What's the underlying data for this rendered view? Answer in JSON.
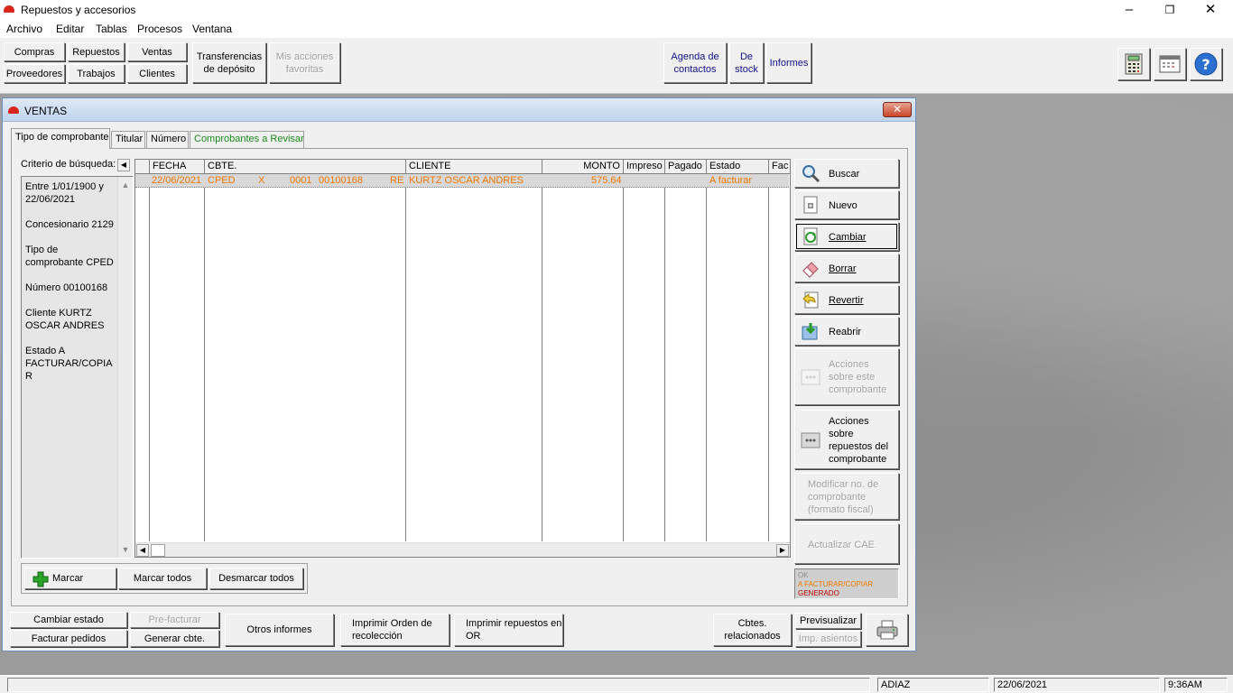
{
  "app": {
    "title": "Repuestos y accesorios"
  },
  "menu": [
    "Archivo",
    "Editar",
    "Tablas",
    "Procesos",
    "Ventana"
  ],
  "toolbar": {
    "compras": "Compras",
    "repuestos": "Repuestos",
    "ventas": "Ventas",
    "proveedores": "Proveedores",
    "trabajos": "Trabajos",
    "clientes": "Clientes",
    "transferencias": "Transferencias de depósito",
    "mis_acciones": "Mis acciones favoritas",
    "agenda": "Agenda de contactos",
    "de_stock": "De stock",
    "informes": "Informes",
    "calculator_icon": "calculator-icon",
    "calendar_icon": "calendar-icon",
    "help_icon": "help-icon"
  },
  "window": {
    "title": "VENTAS",
    "close": "✕"
  },
  "tabs": [
    "Tipo de comprobante",
    "Titular",
    "Número",
    "Comprobantes a Revisar"
  ],
  "criteria": {
    "label": "Criterio de búsqueda:",
    "lines": [
      "Entre  1/01/1900 y 22/06/2021",
      "Concesionario 2129",
      "Tipo de comprobante CPED",
      "Número 00100168",
      "Cliente KURTZ OSCAR ANDRES",
      "Estado A FACTURAR/COPIA R"
    ]
  },
  "grid": {
    "headers": {
      "fecha": "FECHA",
      "cbte": "CBTE.",
      "cliente": "CLIENTE",
      "monto": "MONTO",
      "impreso": "Impreso",
      "pagado": "Pagado",
      "estado": "Estado",
      "fac": "Fac"
    },
    "row": {
      "fecha": "22/06/2021",
      "tipo": "CPED",
      "letra": "X",
      "pv": "0001",
      "numero": "00100168",
      "suf": "RE",
      "cliente": "KURTZ OSCAR ANDRES",
      "monto": "575.64",
      "estado": "A facturar"
    },
    "row_color": "#f07800"
  },
  "actions": {
    "buscar": "Buscar",
    "nuevo": "Nuevo",
    "cambiar": "Cambiar",
    "borrar": "Borrar",
    "revertir": "Revertir",
    "reabrir": "Reabrir",
    "acciones_comprobante": "Acciones sobre este comprobante",
    "acciones_repuestos": "Acciones sobre repuestos del comprobante",
    "modificar_nro": "Modificar no. de comprobante (formato fiscal)",
    "actualizar_cae": "Actualizar CAE"
  },
  "legend": {
    "ok": "OK",
    "a_facturar": "A FACTURAR/COPIAR",
    "generado": "GENERADO",
    "ok_color": "#8a8a8a",
    "a_facturar_color": "#f07800",
    "generado_color": "#c00000"
  },
  "marcar": {
    "marcar": "Marcar",
    "marcar_todos": "Marcar todos",
    "desmarcar_todos": "Desmarcar todos"
  },
  "bottom": {
    "cambiar_estado": "Cambiar estado",
    "pre_facturar": "Pre-facturar",
    "facturar_pedidos": "Facturar pedidos",
    "generar_cbte": "Generar cbte.",
    "otros_informes": "Otros informes",
    "imprimir_orden": "Imprimir Orden de recolección",
    "imprimir_repuestos": "Imprimir repuestos en OR",
    "cbtes_relacionados": "Cbtes. relacionados",
    "previsualizar": "Previsualizar",
    "imp_asientos": "Imp. asientos",
    "printer_icon": "printer-icon"
  },
  "status": {
    "user": "ADIAZ",
    "date": "22/06/2021",
    "time": "9:36AM"
  }
}
